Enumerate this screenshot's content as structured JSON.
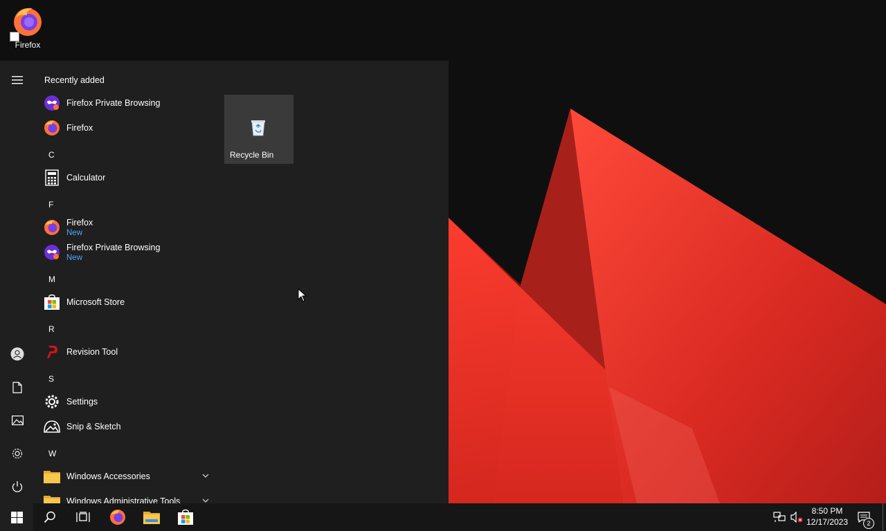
{
  "desktop": {
    "icons": [
      {
        "label": "Firefox"
      }
    ]
  },
  "start_menu": {
    "section_title": "Recently added",
    "recent": [
      {
        "name": "Firefox Private Browsing",
        "icon": "firefox-private-icon"
      },
      {
        "name": "Firefox",
        "icon": "firefox-icon"
      }
    ],
    "groups": [
      {
        "letter": "C",
        "items": [
          {
            "name": "Calculator",
            "icon": "calculator-icon"
          }
        ]
      },
      {
        "letter": "F",
        "items": [
          {
            "name": "Firefox",
            "sub": "New",
            "icon": "firefox-icon"
          },
          {
            "name": "Firefox Private Browsing",
            "sub": "New",
            "icon": "firefox-private-icon"
          }
        ]
      },
      {
        "letter": "M",
        "items": [
          {
            "name": "Microsoft Store",
            "icon": "microsoft-store-icon"
          }
        ]
      },
      {
        "letter": "R",
        "items": [
          {
            "name": "Revision Tool",
            "icon": "revision-tool-icon"
          }
        ]
      },
      {
        "letter": "S",
        "items": [
          {
            "name": "Settings",
            "icon": "gear-icon"
          },
          {
            "name": "Snip & Sketch",
            "icon": "snip-sketch-icon"
          }
        ]
      },
      {
        "letter": "W",
        "items": [
          {
            "name": "Windows Accessories",
            "icon": "folder-icon"
          },
          {
            "name": "Windows Administrative Tools",
            "icon": "folder-icon"
          }
        ]
      }
    ],
    "tile": {
      "label": "Recycle Bin",
      "icon": "recycle-bin-icon"
    },
    "rail": [
      "hamburger-icon",
      "user-icon",
      "document-icon",
      "pictures-icon",
      "gear-icon",
      "power-icon"
    ]
  },
  "taskbar": {
    "clock_time": "8:50 PM",
    "clock_date": "12/17/2023",
    "notification_count": "2"
  },
  "colors": {
    "start_bg": "#1f1f1f",
    "taskbar_bg": "#161617",
    "accent_new": "#4fa6ff",
    "wallpaper_red": "#e8322a"
  }
}
